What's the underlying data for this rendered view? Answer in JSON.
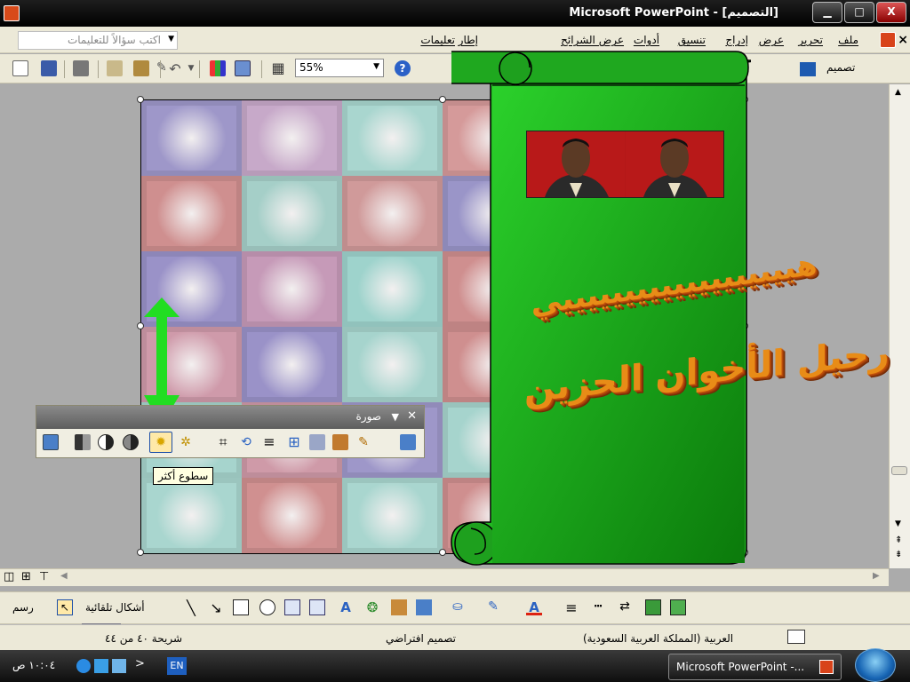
{
  "window": {
    "title": "Microsoft PowerPoint - [التصميم]",
    "minimize_label": "▁",
    "maximize_label": "□",
    "close_label": "X"
  },
  "menu": {
    "items": [
      "ملف",
      "تحرير",
      "عرض",
      "إدراج",
      "تنسيق",
      "أدوات",
      "عرض الشرائح",
      "إطار",
      "تعليمات"
    ],
    "close_doc": "×"
  },
  "help": {
    "placeholder": "اكتب سؤالاً للتعليمات"
  },
  "toolbar": {
    "zoom": "55%",
    "design_label": "تصميم"
  },
  "picture_toolbar": {
    "title": "صورة",
    "tooltip": "سطوع أكثر"
  },
  "slide": {
    "wordart_line1": "هيييييييييييييييييييي",
    "wordart_line2": "رحيل الأخوان الحزين"
  },
  "drawing_toolbar": {
    "draw_label": "رسم",
    "autoshapes_label": "أشكال تلقائية"
  },
  "status": {
    "slide": "شريحة ٤٠ من ٤٤",
    "design": "تصميم افتراضي",
    "language": "العربية (المملكة العربية السعودية)"
  },
  "taskbar": {
    "task_label": "Microsoft PowerPoint -...",
    "language": "EN",
    "clock": "١٠:٠٤ ص"
  },
  "colors": {
    "banner_green": "#22b822",
    "arrow_green": "#22dd22",
    "wordart_orange": "#e88c17"
  }
}
